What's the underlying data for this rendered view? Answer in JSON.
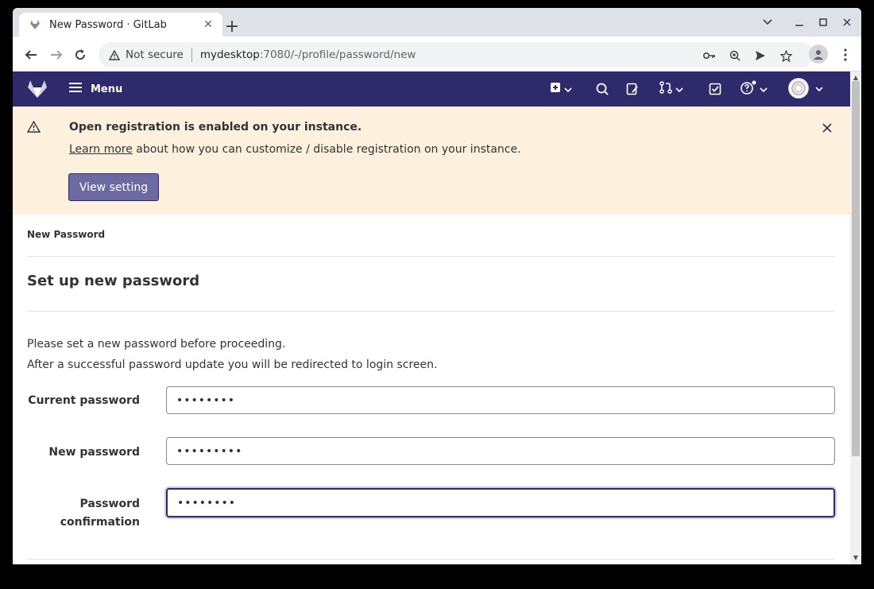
{
  "browser": {
    "tab_title": "New Password · GitLab",
    "tab_close": "✕",
    "newtab": "+",
    "security_label": "Not secure",
    "url_host": "mydesktop",
    "url_path": ":7080/-/profile/password/new"
  },
  "navbar": {
    "menu_label": "Menu"
  },
  "alert": {
    "title": "Open registration is enabled on your instance.",
    "link_text": "Learn more",
    "body_text": " about how you can customize / disable registration on your instance.",
    "button_label": "View setting"
  },
  "page": {
    "breadcrumb": "New Password",
    "title": "Set up new password",
    "intro_1": "Please set a new password before proceeding.",
    "intro_2": "After a successful password update you will be redirected to login screen."
  },
  "form": {
    "current_password_label": "Current password",
    "current_password_value": "••••••••",
    "new_password_label": "New password",
    "new_password_value": "•••••••••",
    "confirmation_label_line1": "Password",
    "confirmation_label_line2": "confirmation",
    "confirmation_value": "••••••••"
  },
  "colors": {
    "navbar_bg": "#2f2a6b",
    "alert_bg": "#fdf1dd",
    "button_bg": "#6b6aa1"
  },
  "icons": [
    "gitlab-tanuki-icon",
    "close-icon",
    "plus-icon",
    "back-arrow-icon",
    "forward-arrow-icon",
    "reload-icon",
    "warning-icon",
    "key-icon",
    "zoom-icon",
    "send-icon",
    "star-icon",
    "profile-icon",
    "kebab-menu-icon",
    "hamburger-icon",
    "create-new-icon",
    "search-icon",
    "issues-icon",
    "merge-request-icon",
    "todo-icon",
    "help-icon",
    "chevron-down-icon",
    "minimize-icon",
    "maximize-icon"
  ]
}
